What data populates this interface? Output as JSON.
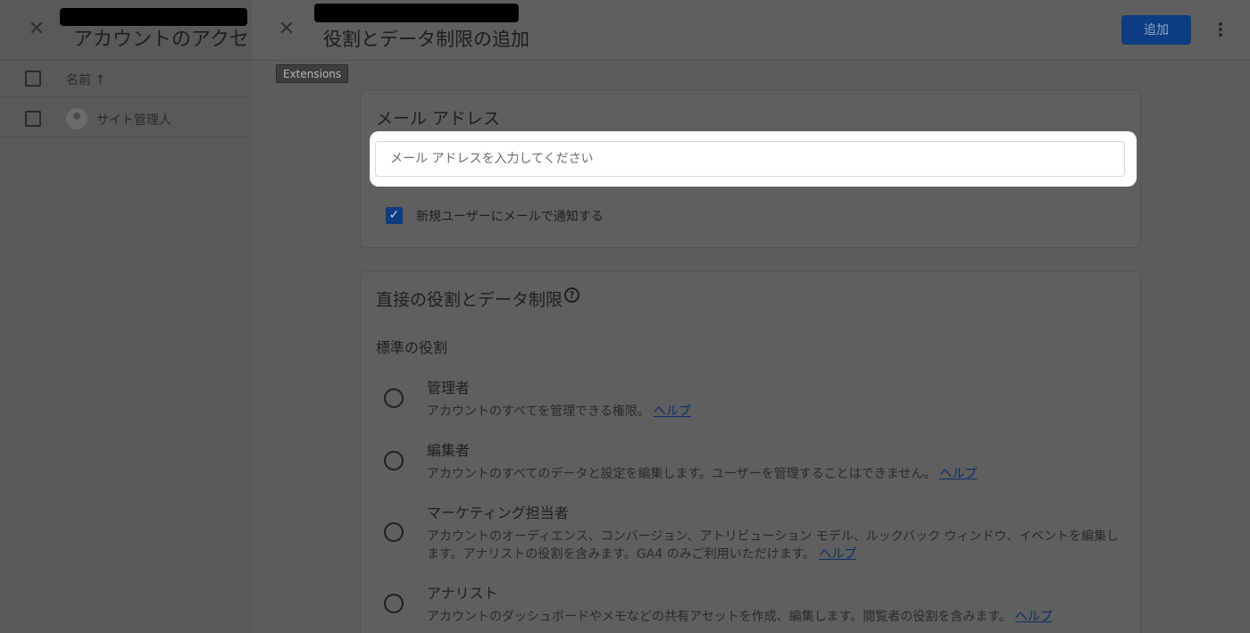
{
  "background": {
    "title": "アカウントのアクセ",
    "column_header": "名前 ↑",
    "user_name": "サイト管理人",
    "close_glyph": "✕"
  },
  "drawer": {
    "close_glyph": "✕",
    "title": "役割とデータ制限の追加",
    "add_label": "追加",
    "tooltip": "Extensions"
  },
  "email_card": {
    "heading": "メール アドレス",
    "input_placeholder": "メール アドレスを入力してください",
    "input_value": "",
    "notify_checked": true,
    "notify_label": "新規ユーザーにメールで通知する"
  },
  "roles_card": {
    "heading": "直接の役割とデータ制限",
    "help_glyph": "?",
    "standard_roles_label": "標準の役割",
    "roles": [
      {
        "name": "管理者",
        "desc": "アカウントのすべてを管理できる権限。",
        "help": "ヘルプ"
      },
      {
        "name": "編集者",
        "desc": "アカウントのすべてのデータと設定を編集します。ユーザーを管理することはできません。",
        "help": "ヘルプ"
      },
      {
        "name": "マーケティング担当者",
        "desc": "アカウントのオーディエンス、コンバージョン、アトリビューション モデル、ルックバック ウィンドウ、イベントを編集します。アナリストの役割を含みます。GA4 のみご利用いただけます。",
        "help": "ヘルプ"
      },
      {
        "name": "アナリスト",
        "desc": "アカウントのダッシュボードやメモなどの共有アセットを作成、編集します。閲覧者の役割を含みます。",
        "help": "ヘルプ"
      }
    ]
  },
  "colors": {
    "primary": "#1a73e8",
    "scrim": "#585858"
  }
}
